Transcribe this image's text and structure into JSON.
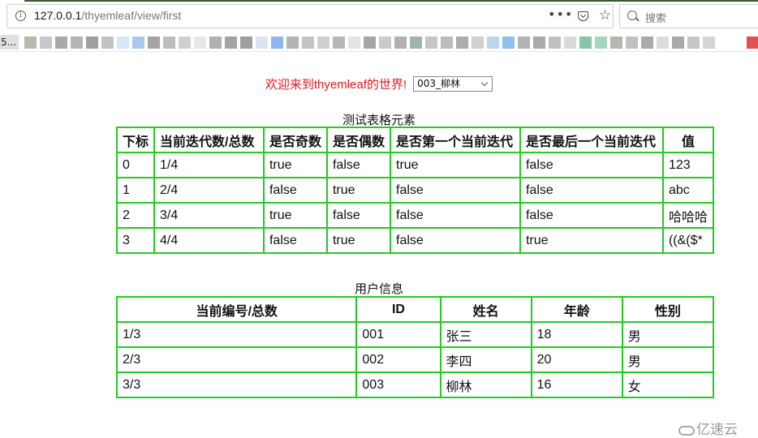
{
  "browser": {
    "url_host": "127.0.0.1",
    "url_path": "/thyemleaf/view/first",
    "search_placeholder": "搜索",
    "more_icon": "•••",
    "star_icon": "☆",
    "bookmark_first": "5..."
  },
  "page": {
    "welcome": "欢迎来到thyemleaf的世界!",
    "select_value": "003_柳林",
    "table1": {
      "caption": "测试表格元素",
      "headers": [
        "下标",
        "当前迭代数/总数",
        "是否奇数",
        "是否偶数",
        "是否第一个当前迭代",
        "是否最后一个当前迭代",
        "值"
      ],
      "rows": [
        [
          "0",
          "1/4",
          "true",
          "false",
          "true",
          "false",
          "123"
        ],
        [
          "1",
          "2/4",
          "false",
          "true",
          "false",
          "false",
          "abc"
        ],
        [
          "2",
          "3/4",
          "true",
          "false",
          "false",
          "false",
          "哈哈哈"
        ],
        [
          "3",
          "4/4",
          "false",
          "true",
          "false",
          "true",
          "((&($*"
        ]
      ]
    },
    "table2": {
      "caption": "用户信息",
      "headers": [
        "当前编号/总数",
        "ID",
        "姓名",
        "年龄",
        "性别"
      ],
      "rows": [
        [
          "1/3",
          "001",
          "张三",
          "18",
          "男"
        ],
        [
          "2/3",
          "002",
          "李四",
          "20",
          "男"
        ],
        [
          "3/3",
          "003",
          "柳林",
          "16",
          "女"
        ]
      ]
    },
    "watermark": "亿速云"
  },
  "colors": {
    "welcome_text": "#e8191d",
    "table_border": "#22cc22"
  }
}
